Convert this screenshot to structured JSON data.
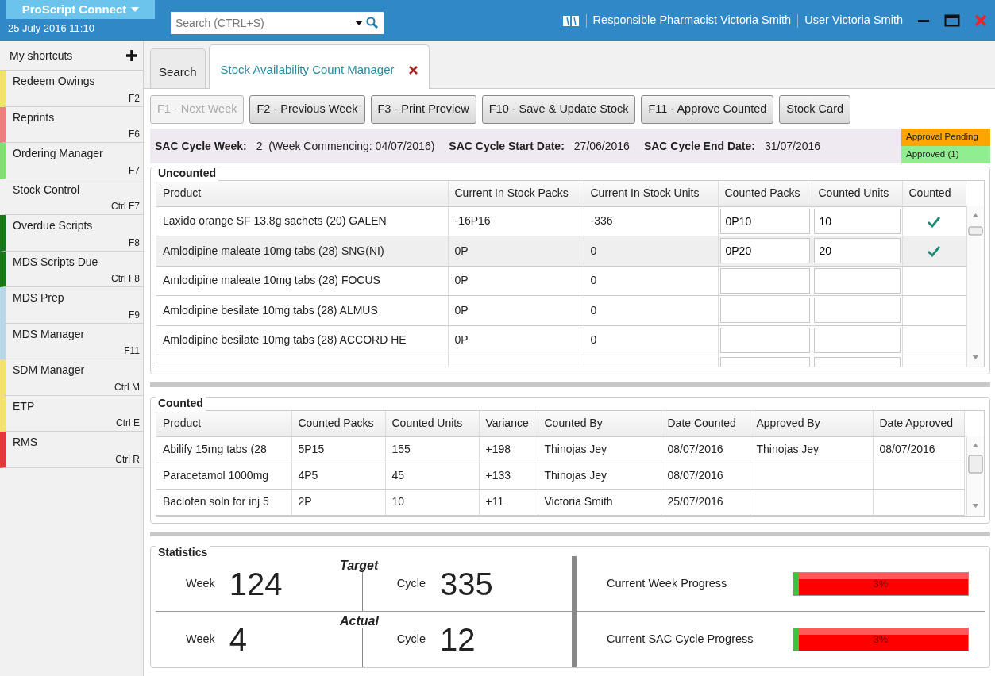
{
  "app": {
    "title": "ProScript Connect",
    "datetime": "25 July 2016 11:10"
  },
  "search": {
    "placeholder": "Search (CTRL+S)"
  },
  "header": {
    "pharmacist_label": "Responsible Pharmacist",
    "pharmacist": "Victoria Smith",
    "user_label": "User",
    "user": "Victoria Smith"
  },
  "shortcuts": {
    "title": "My shortcuts",
    "items": [
      {
        "label": "Redeem Owings",
        "key": "F2",
        "color": "#f3e36b"
      },
      {
        "label": "Reprints",
        "key": "F6",
        "color": "#ef7f7f"
      },
      {
        "label": "Ordering Manager",
        "key": "F7",
        "color": "#7fe06f"
      },
      {
        "label": "Stock Control",
        "key": "Ctrl F7"
      },
      {
        "label": "Overdue Scripts",
        "key": "F8",
        "color": "#167a16"
      },
      {
        "label": "MDS Scripts Due",
        "key": "Ctrl F8",
        "color": "#167a16"
      },
      {
        "label": "MDS Prep",
        "key": "F9",
        "color": "#b8d8ea"
      },
      {
        "label": "MDS Manager",
        "key": "F11",
        "color": "#b8d8ea"
      },
      {
        "label": "SDM Manager",
        "key": "Ctrl M",
        "color": "#f3e36b"
      },
      {
        "label": "ETP",
        "key": "Ctrl E",
        "color": "#f3e36b"
      },
      {
        "label": "RMS",
        "key": "Ctrl R",
        "color": "#e8343b"
      }
    ]
  },
  "tabs": [
    {
      "label": "Search",
      "selected": false,
      "closable": false
    },
    {
      "label": "Stock Availability Count Manager",
      "selected": true,
      "closable": true
    }
  ],
  "toolbar": [
    {
      "label": "F1 - Next Week",
      "disabled": true
    },
    {
      "label": "F2 - Previous Week",
      "disabled": false
    },
    {
      "label": "F3 - Print Preview",
      "disabled": false
    },
    {
      "label": "F10 - Save & Update Stock",
      "disabled": false
    },
    {
      "label": "F11 - Approve Counted",
      "disabled": false
    },
    {
      "label": "Stock Card",
      "disabled": false
    }
  ],
  "cycle_info": [
    {
      "label": "SAC Cycle Week:",
      "value": "2  (Week Commencing: 04/07/2016)"
    },
    {
      "label": "SAC Cycle Start Date:",
      "value": "27/06/2016"
    },
    {
      "label": "SAC Cycle End Date:",
      "value": "31/07/2016"
    }
  ],
  "legend": [
    {
      "label": "Approval Pending",
      "color": "#ffa500"
    },
    {
      "label": "Approved (1)",
      "color": "#90ee90"
    }
  ],
  "uncounted": {
    "title": "Uncounted",
    "columns": [
      "Product",
      "Current In Stock Packs",
      "Current In Stock Units",
      "Counted Packs",
      "Counted Units",
      "Counted"
    ],
    "rows": [
      {
        "product": "Laxido orange SF 13.8g sachets (20) GALEN",
        "packs": "-16P16",
        "units": "-336",
        "counted_packs": "0P10",
        "counted_units": "10",
        "counted": true,
        "selected": false
      },
      {
        "product": "Amlodipine maleate 10mg tabs (28) SNG(NI)",
        "packs": "0P",
        "units": "0",
        "counted_packs": "0P20",
        "counted_units": "20",
        "counted": true,
        "selected": true
      },
      {
        "product": "Amlodipine maleate 10mg tabs (28) FOCUS",
        "packs": "0P",
        "units": "0",
        "counted": false,
        "selected": false
      },
      {
        "product": "Amlodipine besilate 10mg tabs (28) ALMUS",
        "packs": "0P",
        "units": "0",
        "counted": false,
        "selected": false
      },
      {
        "product": "Amlodipine besilate 10mg tabs (28) ACCORD HE",
        "packs": "0P",
        "units": "0",
        "counted": false,
        "selected": false
      }
    ]
  },
  "counted": {
    "title": "Counted",
    "columns": [
      "Product",
      "Counted Packs",
      "Counted Units",
      "Variance",
      "Counted By",
      "Date Counted",
      "Approved By",
      "Date Approved"
    ],
    "rows": [
      [
        "Abilify 15mg tabs (28",
        "5P15",
        "155",
        "+198",
        "Thinojas Jey",
        "08/07/2016",
        "Thinojas Jey",
        "08/07/2016"
      ],
      [
        "Paracetamol 1000mg",
        "4P5",
        "45",
        "+133",
        "Thinojas Jey",
        "08/07/2016",
        "",
        ""
      ],
      [
        "Baclofen soln for inj 5",
        "2P",
        "10",
        "+11",
        "Victoria Smith",
        "25/07/2016",
        "",
        ""
      ]
    ]
  },
  "statistics": {
    "title": "Statistics",
    "rows": [
      {
        "heading": "Target",
        "week_label": "Week",
        "week": "124",
        "cycle_label": "Cycle",
        "cycle": "335",
        "progress_label": "Current Week Progress",
        "level": 0.03,
        "reading": "3%"
      },
      {
        "heading": "Actual",
        "week_label": "Week",
        "week": "4",
        "cycle_label": "Cycle",
        "cycle": "12",
        "progress_label": "Current SAC Cycle Progress",
        "level": 0.03,
        "reading": "3%"
      }
    ]
  }
}
